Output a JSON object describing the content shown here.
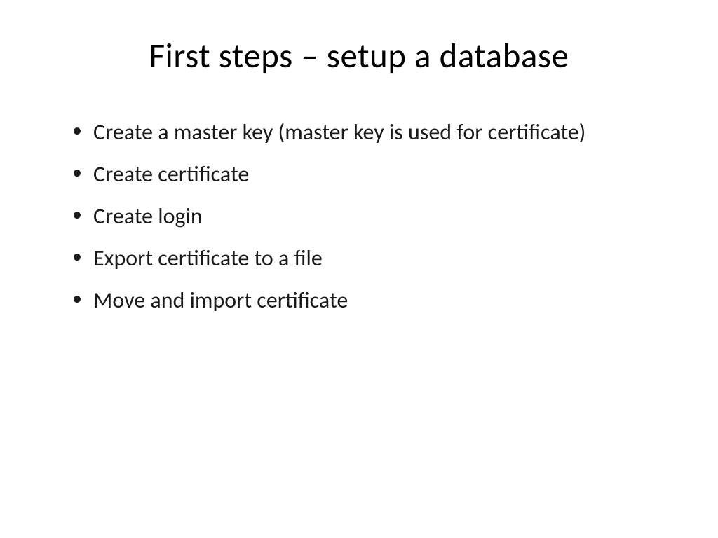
{
  "slide": {
    "title": "First steps – setup a database",
    "bullets": [
      "Create a master key (master key is used for certificate)",
      "Create certificate",
      "Create login",
      "Export certificate to a file",
      "Move and import certificate"
    ]
  }
}
